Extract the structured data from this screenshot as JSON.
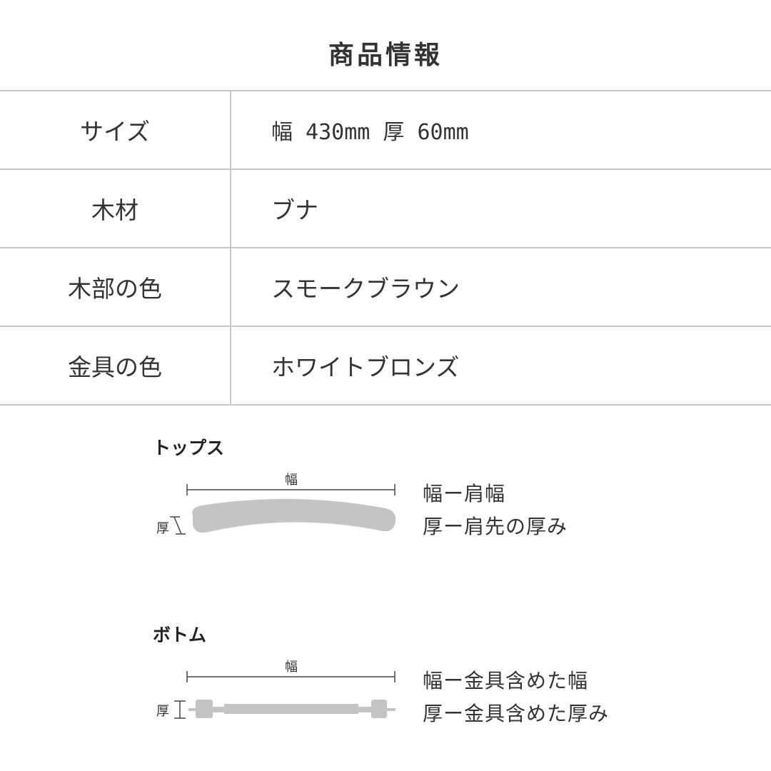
{
  "page": {
    "title": "商品情報"
  },
  "specs": [
    {
      "label": "サイズ",
      "value": "幅 430mm 厚 60mm"
    },
    {
      "label": "木材",
      "value": "ブナ"
    },
    {
      "label": "木部の色",
      "value": "スモークブラウン"
    },
    {
      "label": "金具の色",
      "value": "ホワイトブロンズ"
    }
  ],
  "tops": {
    "heading": "トップス",
    "width_mark": "幅",
    "thick_mark": "厚",
    "legend_width": "幅ー肩幅",
    "legend_thick": "厚ー肩先の厚み"
  },
  "bottoms": {
    "heading": "ボトム",
    "width_mark": "幅",
    "thick_mark": "厚",
    "legend_width": "幅ー金具含めた幅",
    "legend_thick": "厚ー金具含めた厚み"
  },
  "colors": {
    "line": "#c8c8c8",
    "shape": "#c4c4c4",
    "dim": "#444444"
  }
}
